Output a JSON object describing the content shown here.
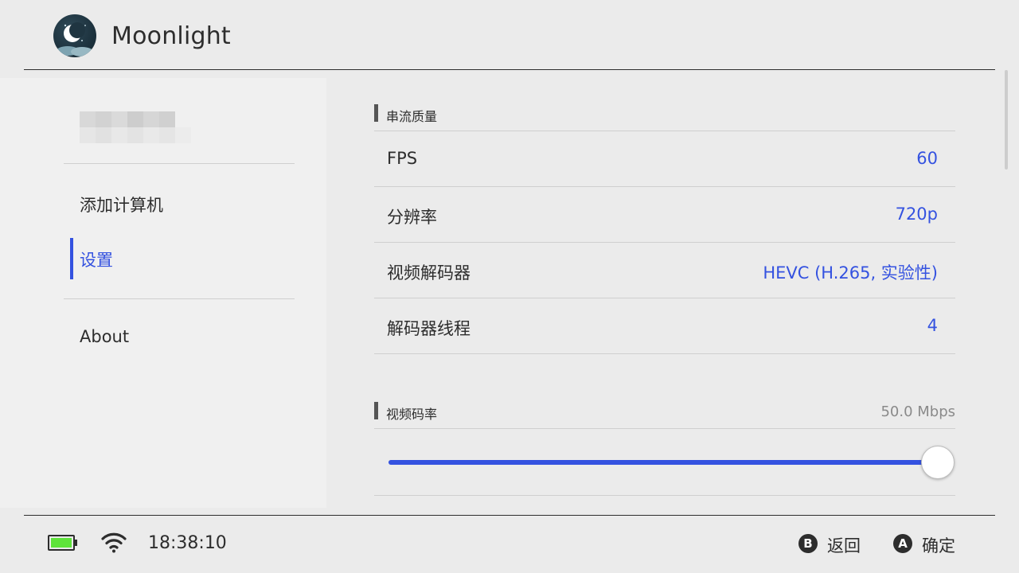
{
  "header": {
    "title": "Moonlight"
  },
  "sidebar": {
    "items": [
      {
        "label": "添加计算机"
      },
      {
        "label": "设置"
      },
      {
        "label": "About"
      }
    ]
  },
  "stream_quality": {
    "title": "串流质量",
    "rows": [
      {
        "label": "FPS",
        "value": "60"
      },
      {
        "label": "分辨率",
        "value": "720p"
      },
      {
        "label": "视频解码器",
        "value": "HEVC (H.265, 实验性)"
      },
      {
        "label": "解码器线程",
        "value": "4"
      }
    ]
  },
  "bitrate": {
    "title": "视频码率",
    "value": "50.0 Mbps",
    "fraction": 1.0
  },
  "status": {
    "time": "18:38:10",
    "battery_level": 1.0
  },
  "hints": [
    {
      "button": "B",
      "label": "返回"
    },
    {
      "button": "A",
      "label": "确定"
    }
  ],
  "colors": {
    "accent": "#3452e0",
    "battery": "#5ee33a",
    "background": "#ebebeb",
    "sidebar": "#f0f0f0"
  }
}
